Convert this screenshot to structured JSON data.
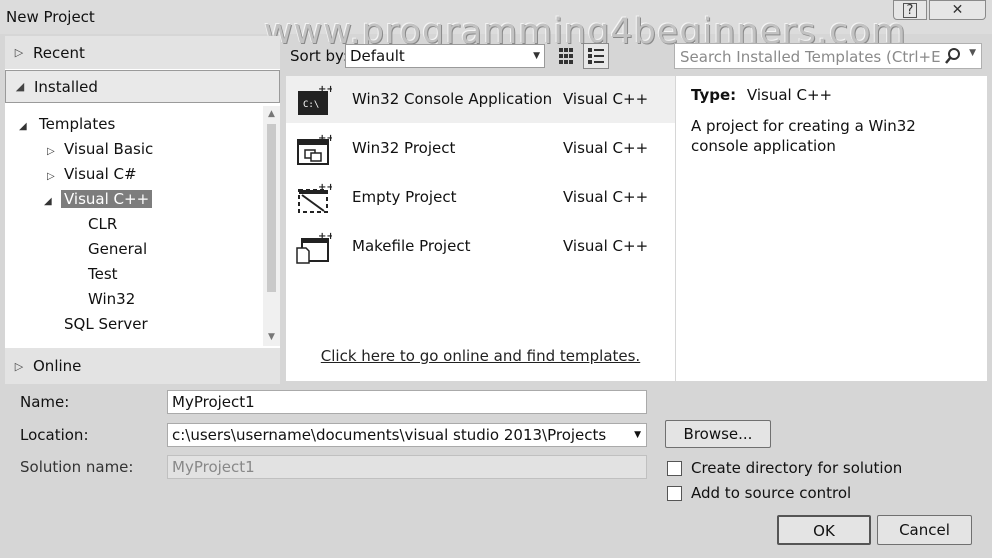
{
  "window": {
    "title": "New Project",
    "watermark": "www.programming4beginners.com",
    "help_label": "?",
    "close_label": "✕"
  },
  "left_pane": {
    "recent": "Recent",
    "installed": "Installed",
    "online": "Online",
    "tree": {
      "templates": "Templates",
      "visual_basic": "Visual Basic",
      "visual_csharp": "Visual C#",
      "visual_cpp": "Visual C++",
      "clr": "CLR",
      "general": "General",
      "test": "Test",
      "win32": "Win32",
      "sql_server": "SQL Server"
    }
  },
  "toolbar": {
    "sort_label": "Sort by:",
    "sort_value": "Default",
    "search_placeholder": "Search Installed Templates (Ctrl+E)"
  },
  "templates": [
    {
      "name": "Win32 Console Application",
      "language": "Visual C++",
      "icon": "console-app-icon"
    },
    {
      "name": "Win32 Project",
      "language": "Visual C++",
      "icon": "win32-project-icon"
    },
    {
      "name": "Empty Project",
      "language": "Visual C++",
      "icon": "empty-project-icon"
    },
    {
      "name": "Makefile Project",
      "language": "Visual C++",
      "icon": "makefile-project-icon"
    }
  ],
  "online_link": "Click here to go online and find templates.",
  "info": {
    "type_label": "Type:",
    "type_value": "Visual C++",
    "description": "A project for creating a Win32 console application"
  },
  "form": {
    "name_label": "Name:",
    "name_value": "MyProject1",
    "location_label": "Location:",
    "location_value": "c:\\users\\username\\documents\\visual studio 2013\\Projects",
    "solution_label": "Solution name:",
    "solution_value": "MyProject1",
    "browse_label": "Browse...",
    "create_dir_label": "Create directory for solution",
    "add_source_label": "Add to source control",
    "ok_label": "OK",
    "cancel_label": "Cancel"
  }
}
